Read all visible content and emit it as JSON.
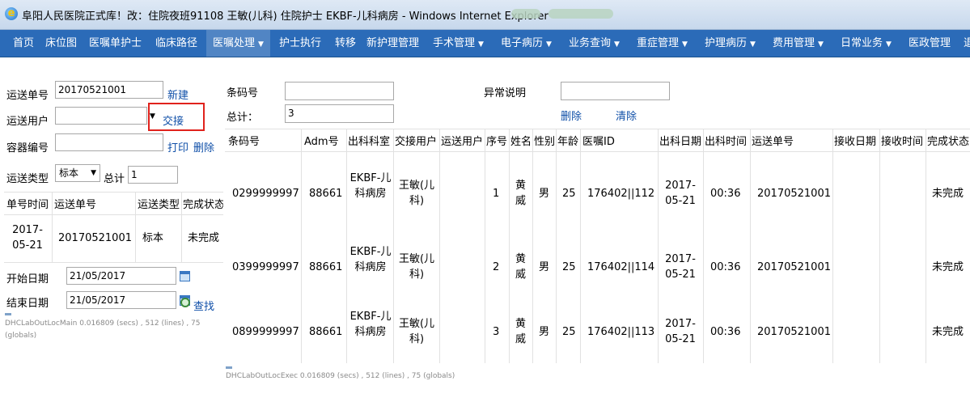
{
  "window": {
    "title": "阜阳人民医院正式库！改：住院夜班91108 王敏(儿科) 住院护士 EKBF-儿科病房 - Windows Internet Explorer"
  },
  "menu": [
    {
      "label": "首页"
    },
    {
      "label": "床位图"
    },
    {
      "label": "医嘱单护士"
    },
    {
      "label": "临床路径"
    },
    {
      "label": "医嘱处理"
    },
    {
      "label": "护士执行"
    },
    {
      "label": "转移"
    },
    {
      "label": "新护理管理"
    },
    {
      "label": "手术管理"
    },
    {
      "label": "电子病历"
    },
    {
      "label": "业务查询"
    },
    {
      "label": "重症管理"
    },
    {
      "label": "护理病历"
    },
    {
      "label": "费用管理"
    },
    {
      "label": "日常业务"
    },
    {
      "label": "医政管理"
    },
    {
      "label": "退"
    }
  ],
  "left": {
    "transfer_no_label": "运送单号",
    "transfer_no_value": "20170521001",
    "new_link": "新建",
    "transfer_user_label": "运送用户",
    "transfer_user_value": "",
    "handover_link": "交接",
    "container_no_label": "容器编号",
    "container_no_value": "",
    "print_link": "打印",
    "delete_link": "删除",
    "transfer_type_label": "运送类型",
    "transfer_type_value": "标本",
    "total_label": "总计",
    "total_value": "1",
    "mini_table": {
      "headers": [
        "单号时间",
        "运送单号",
        "运送类型",
        "完成状态"
      ],
      "row": {
        "time": "2017-05-21",
        "no": "20170521001",
        "type": "标本",
        "status": "未完成"
      }
    },
    "start_date_label": "开始日期",
    "start_date_value": "21/05/2017",
    "end_date_label": "结束日期",
    "end_date_value": "21/05/2017",
    "search_link": "查找",
    "perf_note": "DHCLabOutLocMain  0.016809 (secs) , 512 (lines) , 75 (globals)"
  },
  "right": {
    "barcode_label": "条码号",
    "barcode_value": "",
    "total_label": "总计：",
    "total_value": "3",
    "exception_label": "异常说明",
    "exception_value": "",
    "delete_link": "删除",
    "clear_link": "清除",
    "table": {
      "headers": [
        "条码号",
        "Adm号",
        "出科科室",
        "交接用户",
        "运送用户",
        "序号",
        "姓名",
        "性别",
        "年龄",
        "医嘱ID",
        "出科日期",
        "出科时间",
        "运送单号",
        "接收日期",
        "接收时间",
        "完成状态"
      ],
      "rows": [
        {
          "barcode": "0299999997",
          "adm": "88661",
          "dept": "EKBF-儿科病房",
          "handover": "王敏(儿科)",
          "transfer": "",
          "seq": "1",
          "name": "黄威",
          "sex": "男",
          "age": "25",
          "order_id": "176402||112",
          "out_date": "2017-05-21",
          "out_time": "00:36",
          "transfer_no": "20170521001",
          "recv_date": "",
          "recv_time": "",
          "status": "未完成"
        },
        {
          "barcode": "0399999997",
          "adm": "88661",
          "dept": "EKBF-儿科病房",
          "handover": "王敏(儿科)",
          "transfer": "",
          "seq": "2",
          "name": "黄威",
          "sex": "男",
          "age": "25",
          "order_id": "176402||114",
          "out_date": "2017-05-21",
          "out_time": "00:36",
          "transfer_no": "20170521001",
          "recv_date": "",
          "recv_time": "",
          "status": "未完成"
        },
        {
          "barcode": "0899999997",
          "adm": "88661",
          "dept": "EKBF-儿科病房",
          "handover": "王敏(儿科)",
          "transfer": "",
          "seq": "3",
          "name": "黄威",
          "sex": "男",
          "age": "25",
          "order_id": "176402||113",
          "out_date": "2017-05-21",
          "out_time": "00:36",
          "transfer_no": "20170521001",
          "recv_date": "",
          "recv_time": "",
          "status": "未完成"
        }
      ]
    },
    "perf_note": "DHCLabOutLocExec  0.016809 (secs) , 512 (lines) , 75 (globals)"
  },
  "colors": {
    "menu_bg": "#2b6bb8",
    "menu_active": "#5185c4",
    "link": "#0f4fa8",
    "highlight_box": "#e0221c"
  }
}
